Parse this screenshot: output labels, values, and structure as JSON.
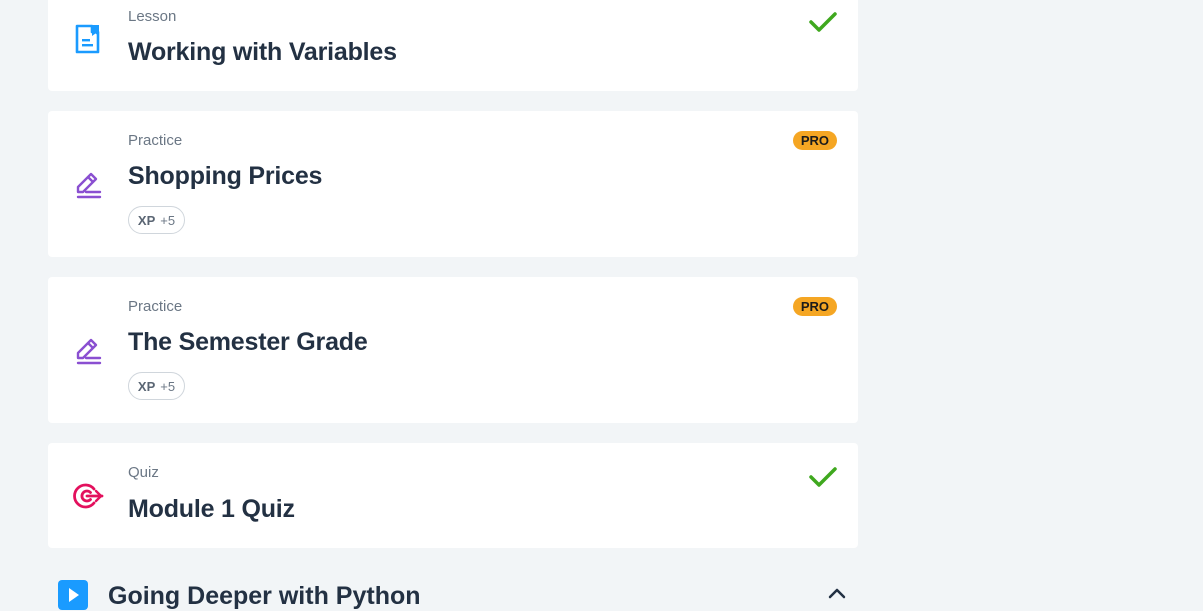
{
  "items": [
    {
      "type": "Lesson",
      "title": "Working with Variables",
      "icon": "lesson-document-icon",
      "status": "completed"
    },
    {
      "type": "Practice",
      "title": "Shopping Prices",
      "icon": "practice-pencil-icon",
      "badge": "PRO",
      "xp": {
        "label": "XP",
        "value": "+5"
      }
    },
    {
      "type": "Practice",
      "title": "The Semester Grade",
      "icon": "practice-pencil-icon",
      "badge": "PRO",
      "xp": {
        "label": "XP",
        "value": "+5"
      }
    },
    {
      "type": "Quiz",
      "title": "Module 1 Quiz",
      "icon": "quiz-target-icon",
      "status": "completed"
    }
  ],
  "next_section": {
    "title": "Going Deeper with Python",
    "icon": "play-icon"
  },
  "colors": {
    "background": "#f2f5f7",
    "lesson_icon": "#1a9bff",
    "practice_icon": "#8a4fd1",
    "quiz_icon": "#e3105d",
    "check": "#3fa81e",
    "pro_badge": "#f5a623"
  }
}
